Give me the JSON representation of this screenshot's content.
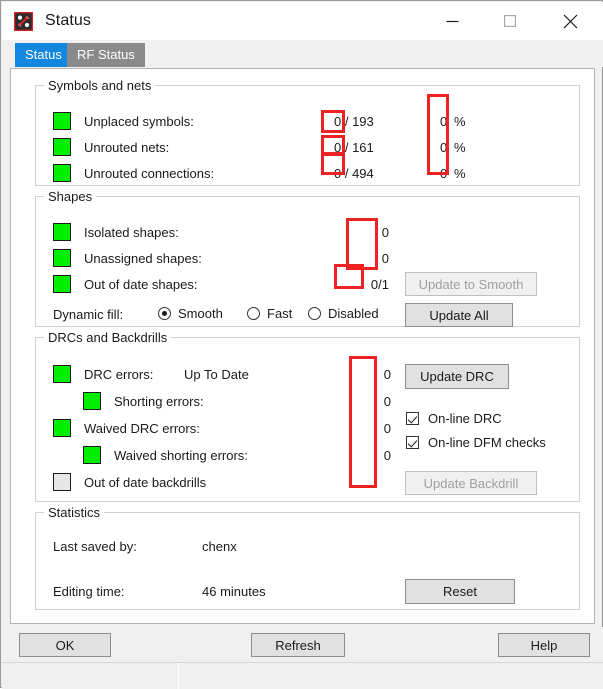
{
  "window": {
    "title": "Status",
    "icon": "allegro-pcb-icon",
    "controls": {
      "minimize": "minimize-icon",
      "maximize": "maximize-icon",
      "close": "close-icon"
    }
  },
  "tabs": [
    {
      "label": "Status",
      "active": true
    },
    {
      "label": "RF Status",
      "active": false
    }
  ],
  "groups": {
    "symbols": {
      "title": "Symbols and nets",
      "rows": [
        {
          "label": "Unplaced symbols:",
          "value": "0 / 193",
          "percent": "0",
          "unit": "%",
          "status": "green"
        },
        {
          "label": "Unrouted nets:",
          "value": "0 / 161",
          "percent": "0",
          "unit": "%",
          "status": "green"
        },
        {
          "label": "Unrouted connections:",
          "value": "0 / 494",
          "percent": "0",
          "unit": "%",
          "status": "green"
        }
      ]
    },
    "shapes": {
      "title": "Shapes",
      "rows": [
        {
          "label": "Isolated shapes:",
          "value": "0",
          "status": "green"
        },
        {
          "label": "Unassigned shapes:",
          "value": "0",
          "status": "green"
        },
        {
          "label": "Out of date shapes:",
          "value": "0/1",
          "status": "green"
        }
      ],
      "dynamic_fill_label": "Dynamic fill:",
      "dynamic_fill_options": [
        {
          "label": "Smooth",
          "selected": true
        },
        {
          "label": "Fast",
          "selected": false
        },
        {
          "label": "Disabled",
          "selected": false
        }
      ],
      "update_to_smooth_label": "Update to Smooth",
      "update_to_smooth_enabled": false,
      "update_all_label": "Update All",
      "update_all_enabled": true
    },
    "drc": {
      "title": "DRCs and Backdrills",
      "rows": [
        {
          "label": "DRC errors:",
          "extra": "Up To Date",
          "value": "0",
          "status": "green",
          "indent": false
        },
        {
          "label": "Shorting errors:",
          "value": "0",
          "status": "green",
          "indent": true
        },
        {
          "label": "Waived DRC errors:",
          "value": "0",
          "status": "green",
          "indent": false
        },
        {
          "label": "Waived shorting errors:",
          "value": "0",
          "status": "green",
          "indent": true
        },
        {
          "label": "Out of date backdrills",
          "value": "",
          "status": "gray",
          "indent": false
        }
      ],
      "update_drc_label": "Update DRC",
      "update_drc_enabled": true,
      "checkboxes": [
        {
          "label": "On-line DRC",
          "checked": true
        },
        {
          "label": "On-line DFM checks",
          "checked": true
        }
      ],
      "update_backdrill_label": "Update Backdrill",
      "update_backdrill_enabled": false
    },
    "statistics": {
      "title": "Statistics",
      "rows": [
        {
          "label": "Last saved by:",
          "value": "chenx"
        },
        {
          "label": "Editing time:",
          "value": "46 minutes"
        }
      ],
      "reset_label": "Reset"
    }
  },
  "footer": {
    "ok_label": "OK",
    "refresh_label": "Refresh",
    "help_label": "Help"
  },
  "annotations": {
    "color": "#ee2222",
    "boxes": [
      {
        "name": "unplaced-symbols-value-highlight"
      },
      {
        "name": "unrouted-nets-value-highlight"
      },
      {
        "name": "unrouted-connections-value-highlight"
      },
      {
        "name": "percent-column-highlight"
      },
      {
        "name": "shapes-counts-highlight"
      },
      {
        "name": "out-of-date-shapes-highlight"
      },
      {
        "name": "drc-error-counts-highlight"
      }
    ]
  }
}
